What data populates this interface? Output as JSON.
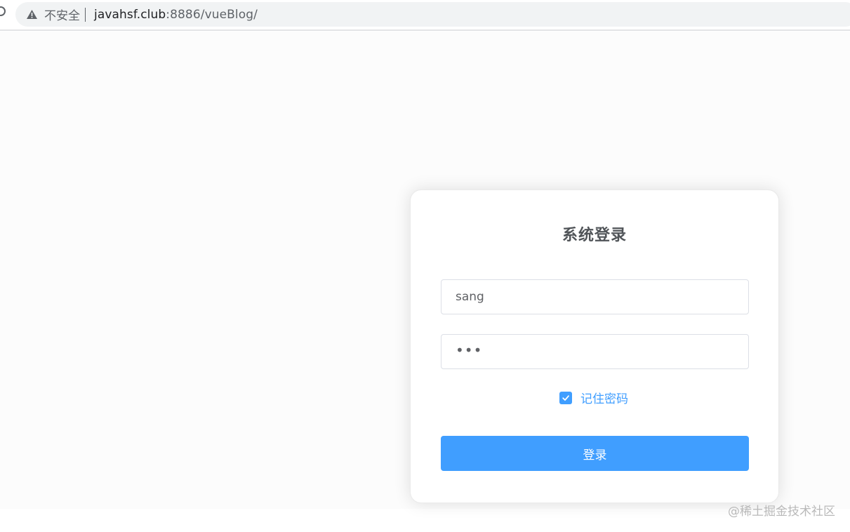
{
  "browser": {
    "security_label": "不安全",
    "url_host": "javahsf.club",
    "url_rest": ":8886/vueBlog/"
  },
  "login": {
    "title": "系统登录",
    "username_value": "sang",
    "password_mask": "•••",
    "remember_label": "记住密码",
    "remember_checked": true,
    "submit_label": "登录",
    "accent_color": "#409eff"
  },
  "watermark": {
    "text": "@稀土掘金技术社区"
  }
}
